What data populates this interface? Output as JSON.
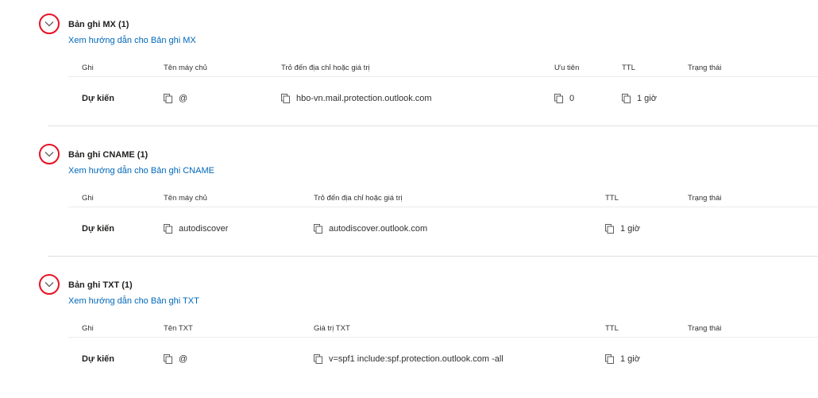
{
  "sections": [
    {
      "title": "Bản ghi MX (1)",
      "guide_link": "Xem hướng dẫn cho Bản ghi MX",
      "headers": [
        "Ghi",
        "Tên máy chủ",
        "Trỏ đến địa chỉ hoặc giá trị",
        "Ưu tiên",
        "TTL",
        "Trạng thái"
      ],
      "row": {
        "label": "Dự kiến",
        "host": "@",
        "value": "hbo-vn.mail.protection.outlook.com",
        "priority": "0",
        "ttl": "1 giờ",
        "status": ""
      }
    },
    {
      "title": "Bản ghi CNAME (1)",
      "guide_link": "Xem hướng dẫn cho Bản ghi CNAME",
      "headers": [
        "Ghi",
        "Tên máy chủ",
        "Trỏ đến địa chỉ hoặc giá trị",
        "TTL",
        "Trạng thái"
      ],
      "row": {
        "label": "Dự kiến",
        "host": "autodiscover",
        "value": "autodiscover.outlook.com",
        "ttl": "1 giờ",
        "status": ""
      }
    },
    {
      "title": "Bản ghi TXT (1)",
      "guide_link": "Xem hướng dẫn cho Bản ghi TXT",
      "headers": [
        "Ghi",
        "Tên TXT",
        "Giá trị TXT",
        "TTL",
        "Trạng thái"
      ],
      "row": {
        "label": "Dự kiến",
        "host": "@",
        "value": "v=spf1 include:spf.protection.outlook.com -all",
        "ttl": "1 giờ",
        "status": ""
      }
    }
  ],
  "colors": {
    "link": "#0067b8",
    "highlight_circle": "#e81123",
    "divider": "#edebe9"
  }
}
